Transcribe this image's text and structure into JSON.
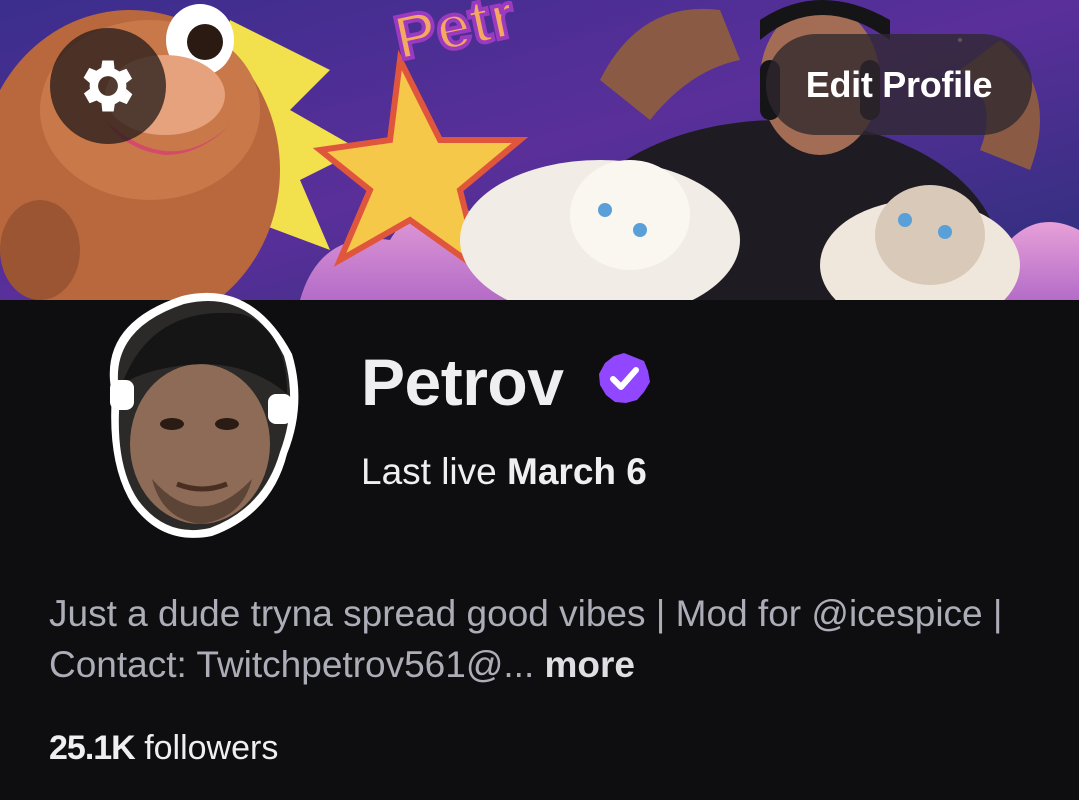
{
  "header": {
    "settings_icon": "gear-icon",
    "edit_profile_label": "Edit Profile"
  },
  "profile": {
    "name": "Petrov",
    "verified_icon": "verified-badge-icon",
    "verified_color": "#9147ff",
    "last_live_prefix": "Last live",
    "last_live_date": "March 6",
    "bio": "Just a dude tryna spread good vibes | Mod for @icespice | Contact: Twitchpetrov561@...",
    "bio_more": "more",
    "followers_count": "25.1K",
    "followers_label": "followers"
  },
  "colors": {
    "background": "#0e0e10",
    "text_primary": "#efeff1",
    "text_secondary": "#adadb8"
  }
}
